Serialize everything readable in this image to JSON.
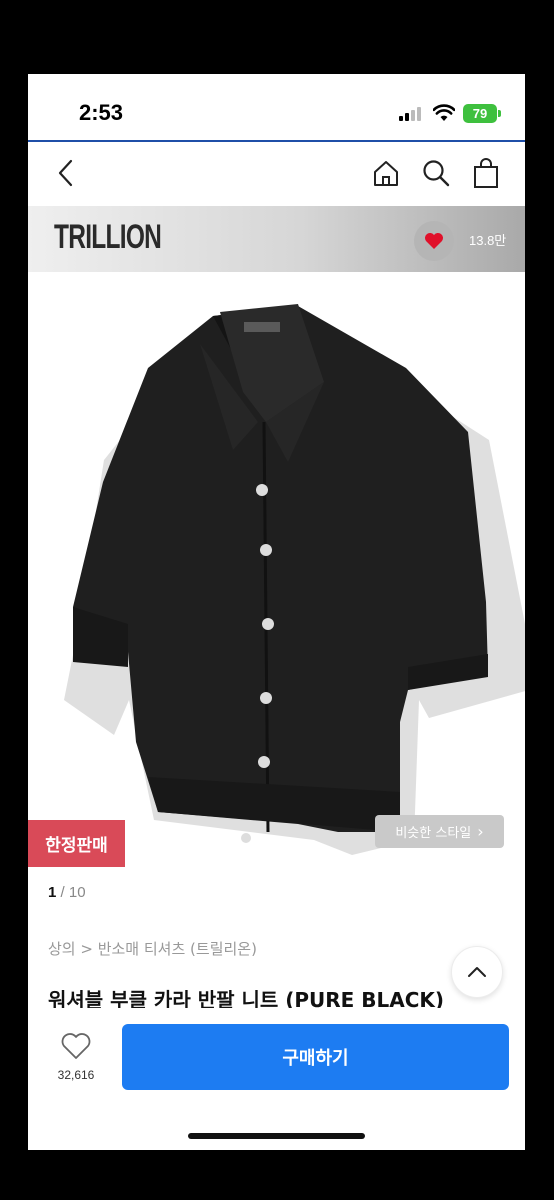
{
  "status": {
    "time": "2:53",
    "battery": "79"
  },
  "nav": {
    "back_icon": "chevron-left-icon",
    "home_icon": "home-icon",
    "search_icon": "search-icon",
    "cart_icon": "shopping-bag-icon"
  },
  "brand": {
    "name": "TRILLION",
    "like_count": "13.8만",
    "like_icon": "heart-icon",
    "heart_color": "#e0102a"
  },
  "gallery": {
    "current": "1",
    "separator": " / ",
    "total": "10",
    "badge": "한정판매",
    "similar_label": "비슷한 스타일",
    "similar_chevron": "›"
  },
  "product": {
    "breadcrumb": "상의 > 반소매 티셔츠 (트릴리온)",
    "title": "워셔블 부클 카라 반팔 니트 (PURE BLACK)"
  },
  "bottom": {
    "wish_count": "32,616",
    "buy_label": "구매하기",
    "buy_color": "#1d7cf2"
  }
}
